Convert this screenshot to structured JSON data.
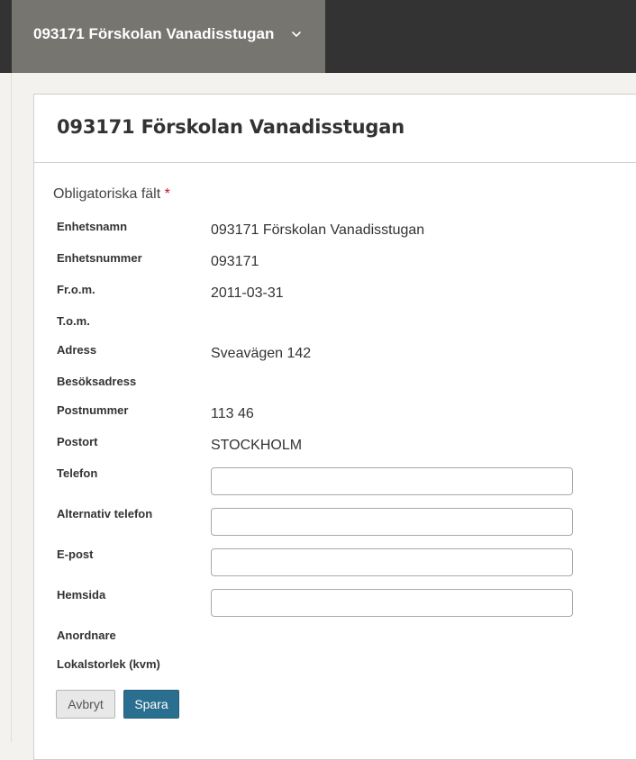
{
  "topbar": {
    "unit_select_label": "093171 Förskolan Vanadisstugan"
  },
  "card": {
    "title": "093171 Förskolan Vanadisstugan",
    "required_note": "Obligatoriska fält",
    "required_marker": "*"
  },
  "fields": {
    "enhetsnamn": {
      "label": "Enhetsnamn",
      "value": "093171 Förskolan Vanadisstugan"
    },
    "enhetsnummer": {
      "label": "Enhetsnummer",
      "value": "093171"
    },
    "from": {
      "label": "Fr.o.m.",
      "value": "2011-03-31"
    },
    "tom": {
      "label": "T.o.m.",
      "value": ""
    },
    "adress": {
      "label": "Adress",
      "value": "Sveavägen 142"
    },
    "besoksadress": {
      "label": "Besöksadress",
      "value": ""
    },
    "postnummer": {
      "label": "Postnummer",
      "value": "113 46"
    },
    "postort": {
      "label": "Postort",
      "value": "STOCKHOLM"
    },
    "telefon": {
      "label": "Telefon",
      "value": ""
    },
    "alt_telefon": {
      "label": "Alternativ telefon",
      "value": ""
    },
    "epost": {
      "label": "E-post",
      "value": ""
    },
    "hemsida": {
      "label": "Hemsida",
      "value": ""
    },
    "anordnare": {
      "label": "Anordnare",
      "value": ""
    },
    "lokalstorlek": {
      "label": "Lokalstorlek (kvm)",
      "value": ""
    }
  },
  "buttons": {
    "cancel_label": "Avbryt",
    "save_label": "Spara"
  },
  "colors": {
    "topbar_bg": "#333333",
    "unit_select_bg": "#767570",
    "page_bg": "#f3f2ee",
    "save_button_bg": "#2a6f8f",
    "required_star": "#c8102e"
  },
  "icons": {
    "unit_select_chevron": "chevron-down-icon"
  }
}
